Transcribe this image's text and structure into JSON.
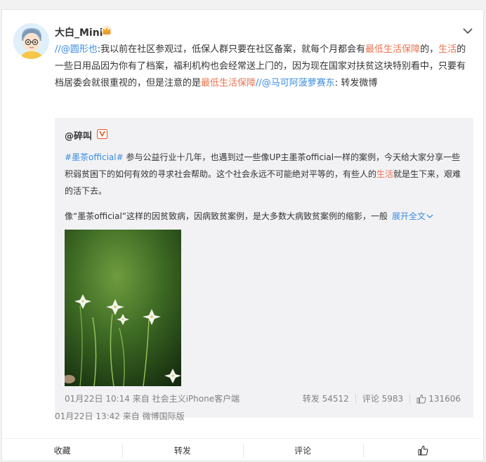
{
  "post": {
    "username": "大白_Mini",
    "text": {
      "prefix": "//",
      "mention1": "@圆形也",
      "seg1": ":我以前在社区参观过，低保人群只要在社区备案，就每个月都会有",
      "link1": "最低生活保障",
      "seg2": "的，",
      "link2": "生活",
      "seg3": "的一些日用品因为你有了档案，福利机构也会经常送上门的，因为现在国家对扶贫这块特别看中，只要有档居委会就很重视的，但是注意的是",
      "link3": "最低生活保障",
      "seg4": "//",
      "mention2": "@马可阿菠萝赛东",
      "seg5": ": 转发微博"
    },
    "meta": "01月22日 13:42  来自 微博国际版"
  },
  "quote": {
    "author": "@碎叫",
    "hashtag": "#墨茶official#",
    "para1_a": " 参与公益行业十几年，也遇到过一些像UP主墨茶official一样的案例，今天给大家分享一些积弱贫困下的如何有效的寻求社会帮助。这个社会永远不可能绝对平等的，有些人的",
    "para1_link": "生活",
    "para1_b": "就是生下来，艰难的活下去。",
    "para2": "像“墨茶official”这样的因贫致病，因病致贫案例，是大多数大病致贫案例的缩影，一般",
    "expand_label": "展开全文",
    "meta": "01月22日 10:14  来自 社会主义iPhone客户端",
    "repost": "转发 54512",
    "comment": "评论 5983",
    "like": "131606"
  },
  "footer": {
    "favorite": "收藏",
    "forward": "转发",
    "comment": "评论"
  },
  "icons": {
    "avatar": "cartoon-avatar",
    "crown": "crown-icon",
    "verified": "v-badge-icon",
    "dropdown": "chevron-down-icon",
    "like": "thumbs-up-icon"
  },
  "colors": {
    "accent_link": "#eb7350",
    "mention": "#3b8de0",
    "quote_bg": "#f2f2f5",
    "crown": "#f5a623",
    "v_badge": "#e8541e"
  }
}
